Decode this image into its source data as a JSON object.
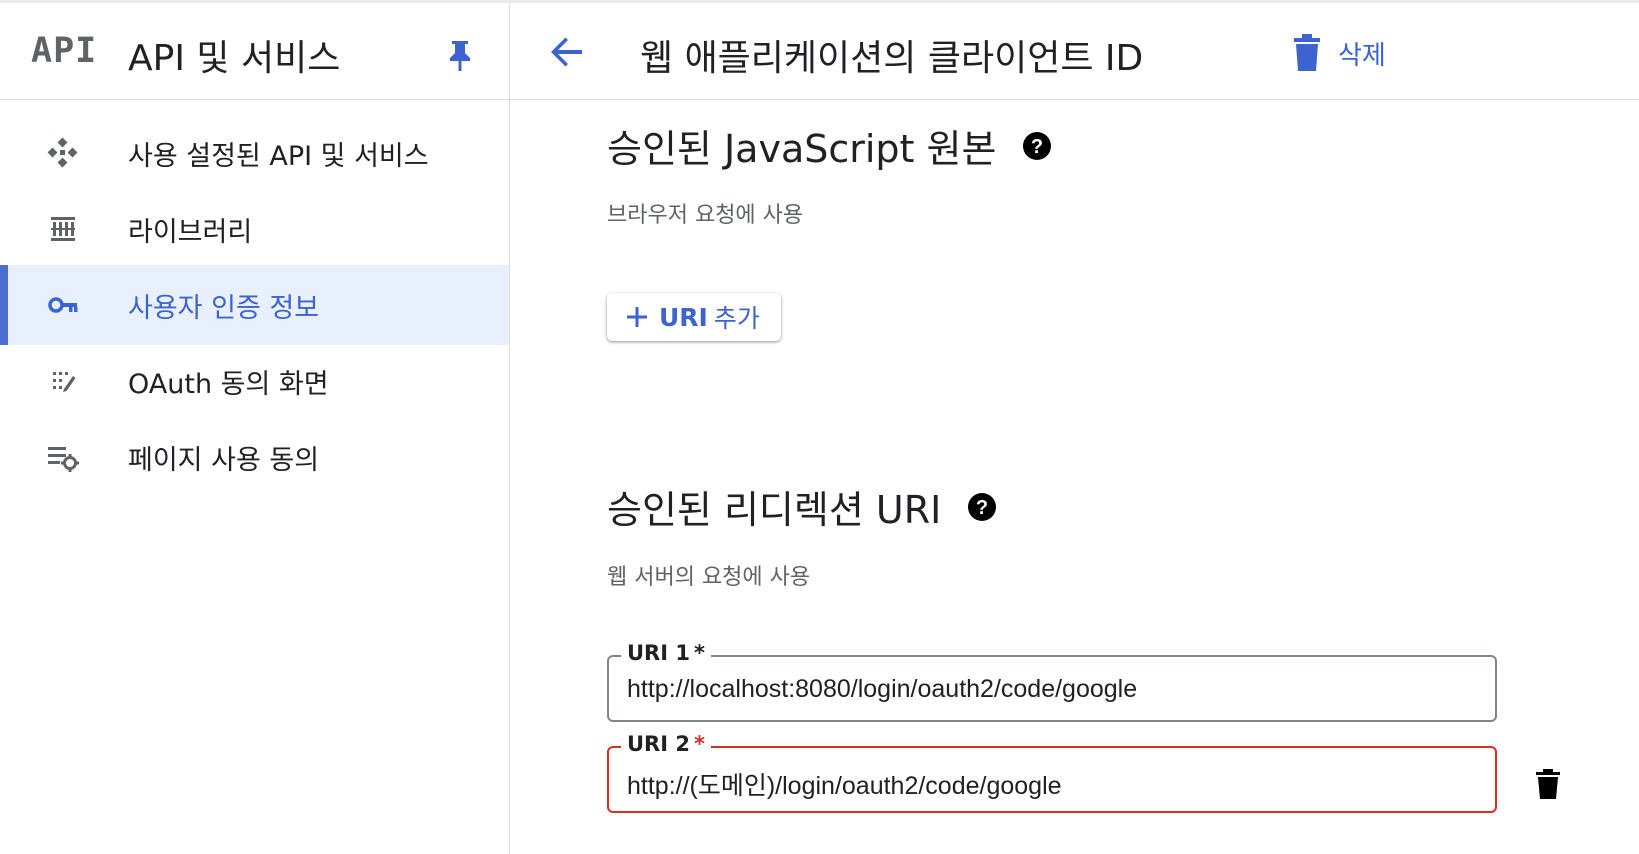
{
  "sidebar": {
    "logo": "API",
    "title": "API 및 서비스",
    "items": [
      {
        "label": "사용 설정된 API 및 서비스",
        "icon": "dashboard-diamond-icon"
      },
      {
        "label": "라이브러리",
        "icon": "library-icon"
      },
      {
        "label": "사용자 인증 정보",
        "icon": "key-icon"
      },
      {
        "label": "OAuth 동의 화면",
        "icon": "consent-screen-icon"
      },
      {
        "label": "페이지 사용 동의",
        "icon": "page-settings-icon"
      }
    ],
    "active_index": 2
  },
  "header": {
    "title": "웹 애플리케이션의 클라이언트 ID",
    "delete_label": "삭제"
  },
  "js_origins": {
    "title": "승인된 JavaScript 원본",
    "subtitle": "브라우저 요청에 사용",
    "add_label_strong": "URI",
    "add_label_rest": "추가"
  },
  "redirect_uris": {
    "title": "승인된 리디렉션 URI",
    "subtitle": "웹 서버의 요청에 사용",
    "fields": [
      {
        "label": "URI 1",
        "required_mark": "*",
        "value": "http://localhost:8080/login/oauth2/code/google"
      },
      {
        "label": "URI 2",
        "required_mark": "*",
        "value": "http://(도메인)/login/oauth2/code/google"
      }
    ]
  },
  "colors": {
    "accent": "#3c63cf",
    "active_bg": "#e8f0fe",
    "error": "#d93025",
    "border": "#80868b"
  }
}
